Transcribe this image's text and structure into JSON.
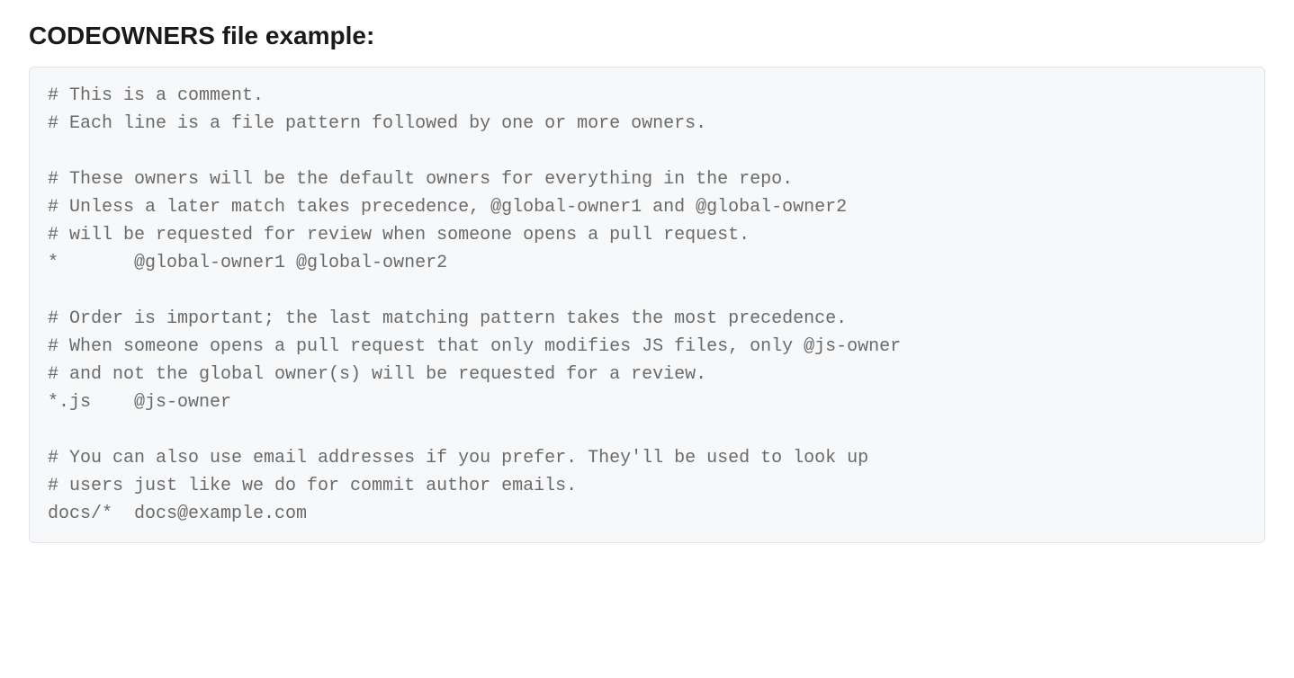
{
  "heading": "CODEOWNERS file example:",
  "code_lines": [
    "# This is a comment.",
    "# Each line is a file pattern followed by one or more owners.",
    "",
    "# These owners will be the default owners for everything in the repo.",
    "# Unless a later match takes precedence, @global-owner1 and @global-owner2",
    "# will be requested for review when someone opens a pull request.",
    "*       @global-owner1 @global-owner2",
    "",
    "# Order is important; the last matching pattern takes the most precedence.",
    "# When someone opens a pull request that only modifies JS files, only @js-owner",
    "# and not the global owner(s) will be requested for a review.",
    "*.js    @js-owner",
    "",
    "# You can also use email addresses if you prefer. They'll be used to look up",
    "# users just like we do for commit author emails.",
    "docs/*  docs@example.com"
  ]
}
